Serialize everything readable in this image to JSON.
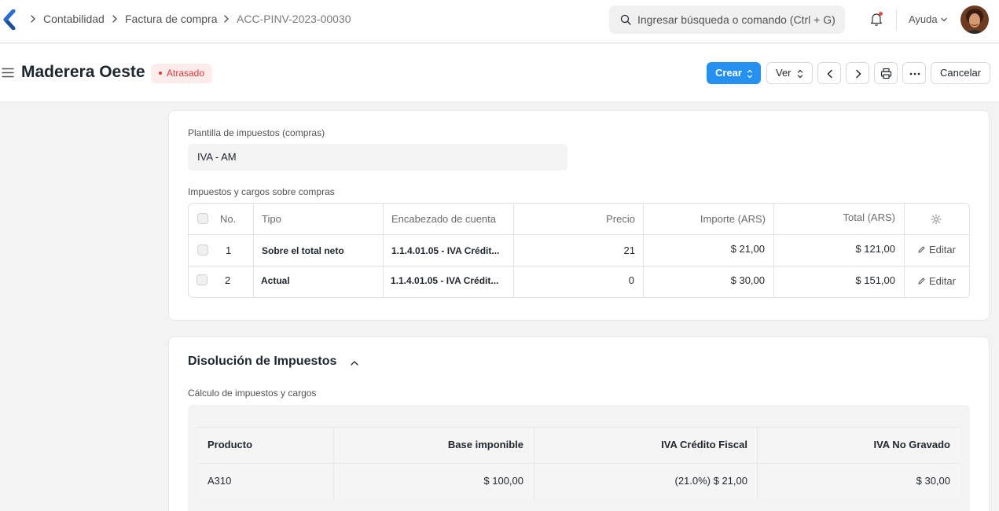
{
  "navbar": {
    "breadcrumbs": [
      "Contabilidad",
      "Factura de compra",
      "ACC-PINV-2023-00030"
    ],
    "search_placeholder": "Ingresar búsqueda o comando (Ctrl + G)",
    "help_label": "Ayuda"
  },
  "header": {
    "title": "Maderera Oeste",
    "status": "Atrasado",
    "create_label": "Crear",
    "view_label": "Ver",
    "cancel_label": "Cancelar"
  },
  "taxes": {
    "template_label": "Plantilla de impuestos (compras)",
    "template_value": "IVA - AM",
    "table_label": "Impuestos y cargos sobre compras",
    "columns": [
      "No.",
      "Tipo",
      "Encabezado de cuenta",
      "Precio",
      "Importe (ARS)",
      "Total (ARS)"
    ],
    "rows": [
      {
        "no": "1",
        "tipo": "Sobre el total neto",
        "cuenta": "1.1.4.01.05 - IVA Crédit...",
        "precio": "21",
        "importe": "$ 21,00",
        "total": "$ 121,00",
        "edit": "Editar"
      },
      {
        "no": "2",
        "tipo": "Actual",
        "cuenta": "1.1.4.01.05 - IVA Crédit...",
        "precio": "0",
        "importe": "$ 30,00",
        "total": "$ 151,00",
        "edit": "Editar"
      }
    ]
  },
  "breakdown": {
    "title": "Disolución de Impuestos",
    "subtitle": "Cálculo de impuestos y cargos",
    "columns": [
      "Producto",
      "Base imponible",
      "IVA Crédito Fiscal",
      "IVA No Gravado"
    ],
    "rows": [
      {
        "producto": "A310",
        "base": "$ 100,00",
        "iva_cf": "(21.0%) $ 21,00",
        "iva_ng": "$ 30,00"
      }
    ]
  },
  "colors": {
    "primary": "#2490ef",
    "danger": "#e03636",
    "background": "#f3f3f3"
  }
}
